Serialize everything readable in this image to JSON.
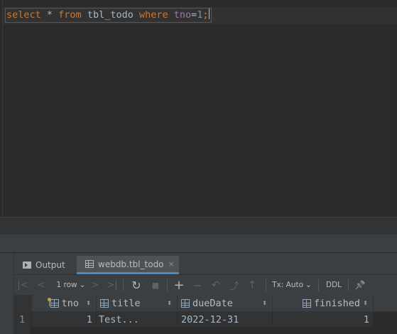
{
  "editor": {
    "sql_tokens": [
      {
        "text": "select",
        "type": "kw"
      },
      {
        "text": " * ",
        "type": "plain"
      },
      {
        "text": "from",
        "type": "kw"
      },
      {
        "text": " tbl_todo ",
        "type": "plain"
      },
      {
        "text": "where",
        "type": "kw"
      },
      {
        "text": " ",
        "type": "plain"
      },
      {
        "text": "tno",
        "type": "col"
      },
      {
        "text": "=",
        "type": "plain"
      },
      {
        "text": "1",
        "type": "num"
      },
      {
        "text": ";",
        "type": "kw"
      }
    ]
  },
  "tabs": {
    "output_label": "Output",
    "table_label": "webdb.tbl_todo",
    "close_glyph": "×"
  },
  "toolbar": {
    "first": "|<",
    "prev": "<",
    "rows_label": "1 row",
    "rows_chevron": "⌄",
    "next": ">",
    "last": ">|",
    "refresh": "↻",
    "stop": "■",
    "add": "+",
    "remove": "−",
    "revert": "↶",
    "submit": "⤴",
    "push": "↑",
    "tx_label": "Tx: Auto",
    "tx_chevron": "⌄",
    "ddl_label": "DDL",
    "pin": "📌"
  },
  "grid": {
    "columns": [
      {
        "label": "tno",
        "icon": "primary-key-column-icon"
      },
      {
        "label": "title",
        "icon": "column-icon"
      },
      {
        "label": "dueDate",
        "icon": "column-icon"
      },
      {
        "label": "finished",
        "icon": "column-icon"
      }
    ],
    "sort_glyph": "⬍",
    "rows": [
      {
        "num": "1",
        "tno": "1",
        "title": "Test...",
        "dueDate": "2022-12-31",
        "finished": "1"
      }
    ]
  },
  "colors": {
    "keyword": "#cc7832",
    "column": "#9876aa",
    "number": "#6897bb",
    "text": "#a9b7c6",
    "selected_tab_underline": "#4a88c7"
  }
}
